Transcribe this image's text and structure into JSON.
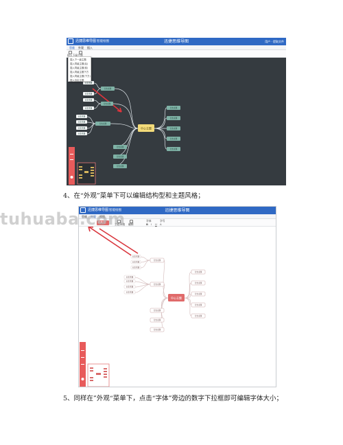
{
  "screenshot_1": {
    "app_name": "迅捷思维导图",
    "file_tab": "智能绘图",
    "doc_title": "迅捷思维导图",
    "user": "用户 · 提取文件",
    "menu": [
      "思维",
      "外观",
      "插入"
    ],
    "toolbar": [
      "插入下级主题",
      "插入上级主题"
    ],
    "dropdown_items": [
      "插入下一级主题",
      "插入同级主题(后)",
      "插入同级主题(前)",
      "插入同级主题下方",
      "插入同级主题(下方)",
      "插入自由主题"
    ],
    "central_node": "中心主题",
    "branch_label": "分支主题",
    "sub_label": "分支主题",
    "colors": {
      "canvas": "#353b40",
      "central": "#f3db7a",
      "branch": "#7fb2a6",
      "link": "#dfe6ea",
      "arrow": "#e2343c"
    }
  },
  "caption_4": "4、在“外观”菜单下可以编辑结构型和主题风格；",
  "screenshot_2": {
    "app_name": "迅捷思维导图",
    "file_tab": "智能绘图",
    "doc_title": "迅捷思维导图",
    "menu": [
      "思维",
      "外观",
      "视图"
    ],
    "toolbar": [
      "结构型",
      "主题风格",
      "编辑",
      "字体",
      "字号",
      "B",
      "I",
      "U",
      "A"
    ],
    "central_node": "中心主题",
    "branch_label": "分支主题",
    "sub_label": "分支主题",
    "colors": {
      "canvas": "#ffffff",
      "central": "#e06a6a",
      "node_border": "#c9a6a6",
      "link": "#d8c2c2",
      "arrow": "#d9343b",
      "panel": "#e85b5b"
    }
  },
  "caption_5": "5、同样在”外观“菜单下，点击“字体”旁边的数字下拉框即可编辑字体大小；",
  "watermark": "tuhuaba.com"
}
